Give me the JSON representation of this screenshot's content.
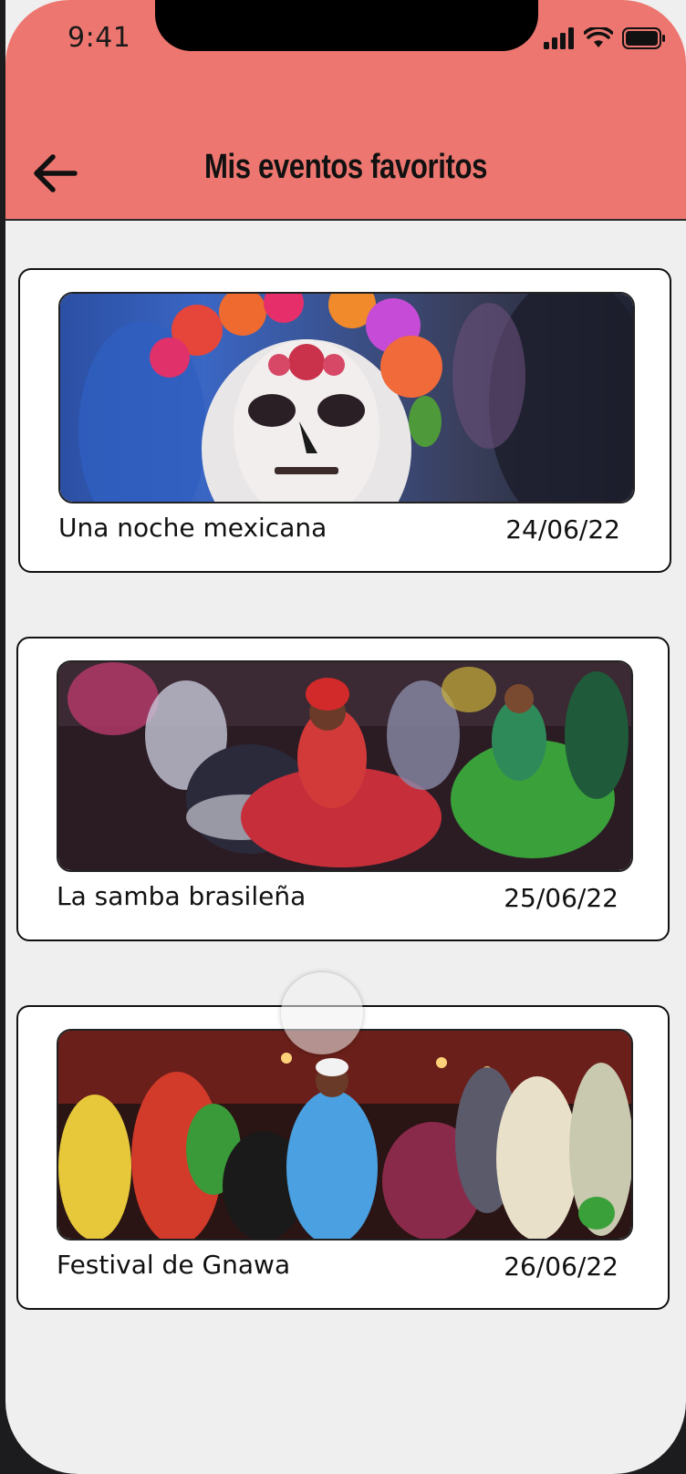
{
  "status_bar": {
    "time": "9:41",
    "icons": [
      "signal-icon",
      "wifi-icon",
      "battery-icon"
    ]
  },
  "header": {
    "title": "Mis eventos favoritos",
    "back_icon": "arrow-left-icon",
    "background_color": "#ed7770"
  },
  "events": [
    {
      "title": "Una noche mexicana",
      "date": "24/06/22",
      "image": "day-of-the-dead-face-paint-photo"
    },
    {
      "title": "La samba brasileña",
      "date": "25/06/22",
      "image": "samba-dancers-photo"
    },
    {
      "title": "Festival de Gnawa",
      "date": "26/06/22",
      "image": "gnawa-musicians-photo"
    }
  ]
}
